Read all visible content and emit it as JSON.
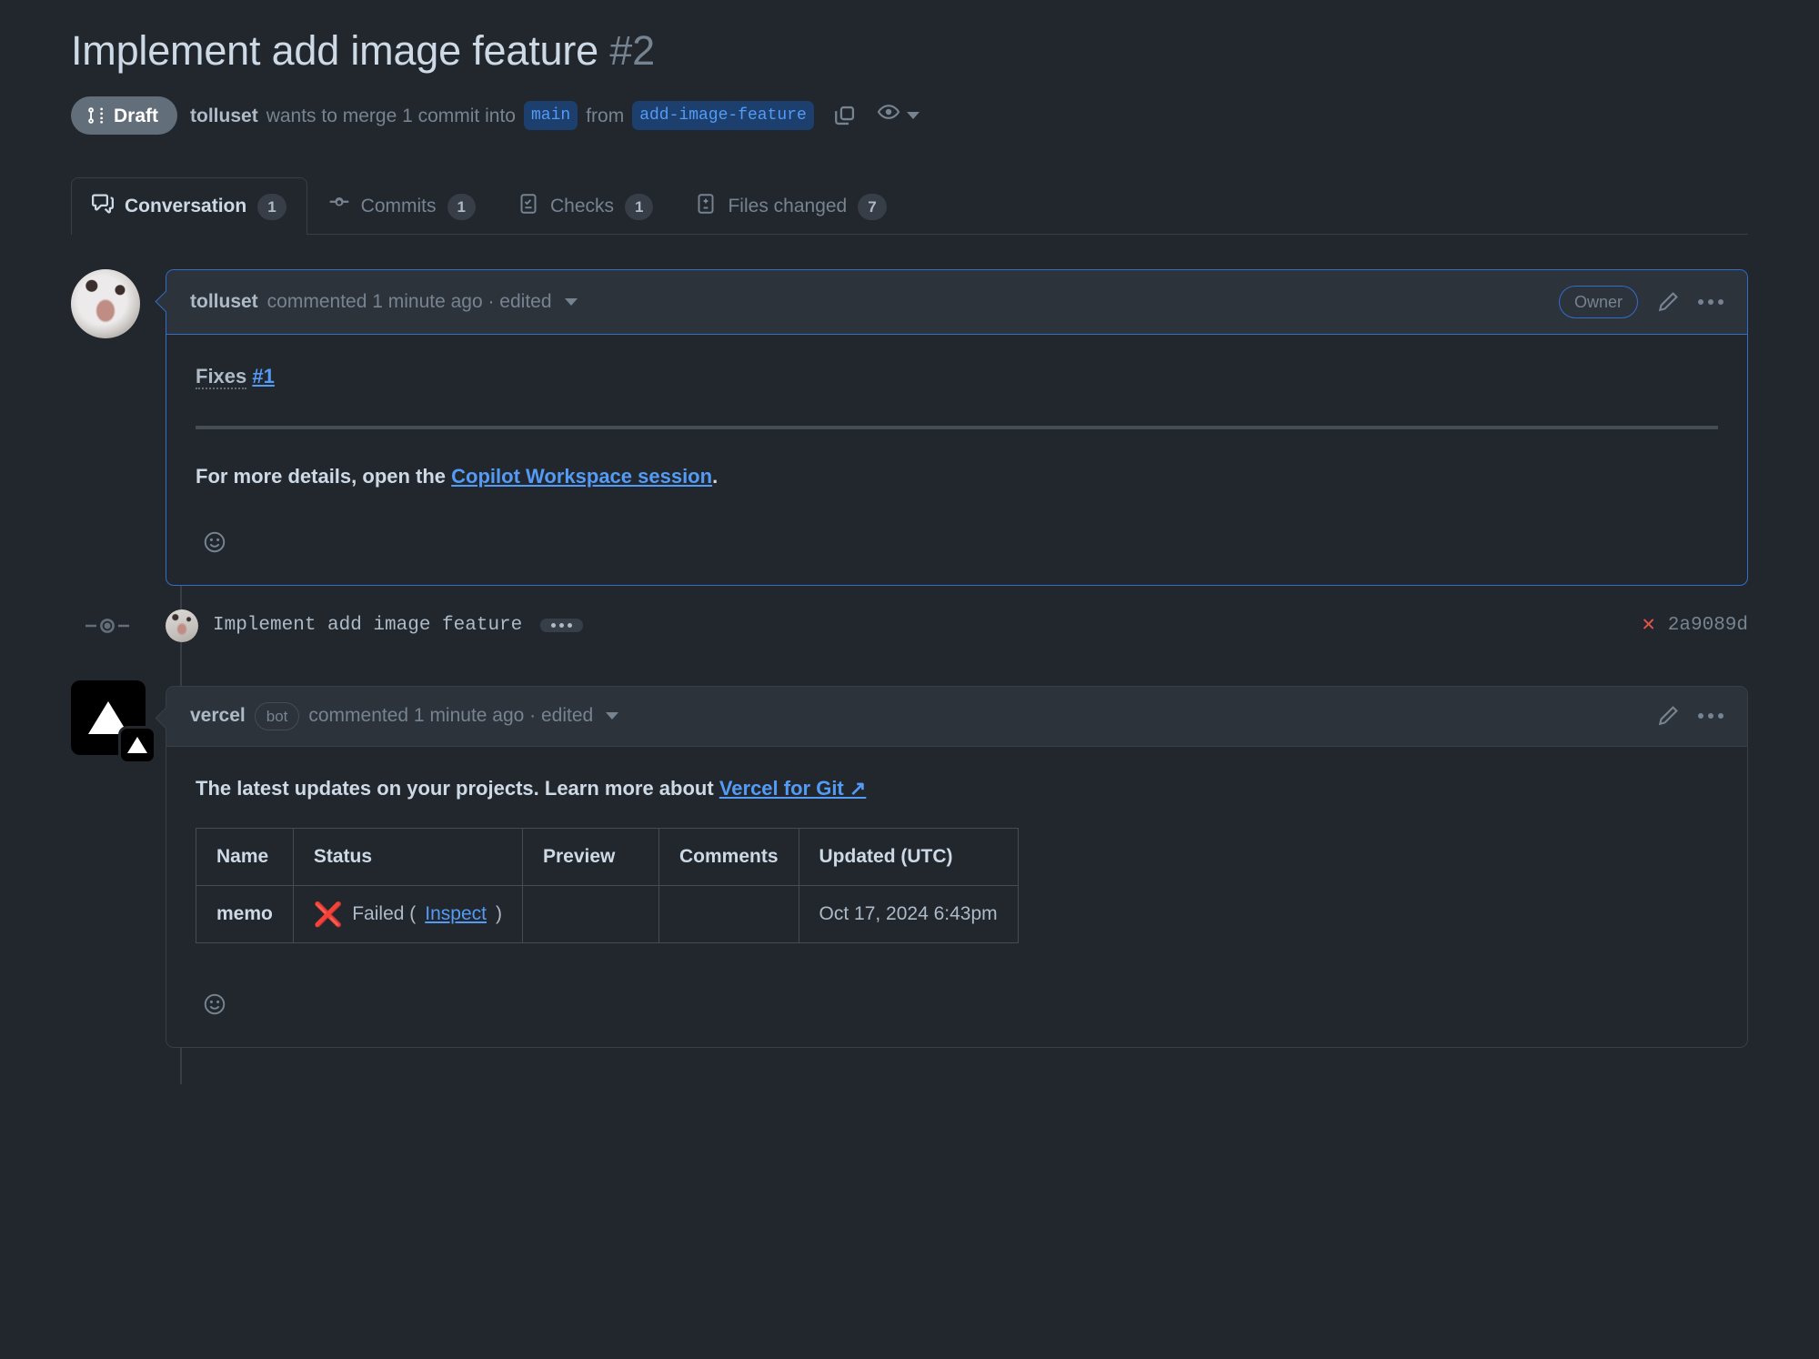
{
  "header": {
    "title": "Implement add image feature",
    "number": "#2",
    "state_badge": {
      "label": "Draft",
      "icon": "git-pull-request-draft-icon"
    },
    "merge_line": {
      "actor": "tolluset",
      "text_before": "wants to merge 1 commit into",
      "base_branch": "main",
      "text_middle": "from",
      "head_branch": "add-image-feature"
    },
    "copy_icon": "copy-icon",
    "watch_icon": "eye-icon"
  },
  "tabs": [
    {
      "label": "Conversation",
      "count": "1",
      "icon": "comment-discussion-icon",
      "active": true
    },
    {
      "label": "Commits",
      "count": "1",
      "icon": "git-commit-icon",
      "active": false
    },
    {
      "label": "Checks",
      "count": "1",
      "icon": "checklist-icon",
      "active": false
    },
    {
      "label": "Files changed",
      "count": "7",
      "icon": "file-diff-icon",
      "active": false
    }
  ],
  "comments": [
    {
      "author": "tolluset",
      "meta": "commented 1 minute ago · edited",
      "badge": "Owner",
      "body": {
        "fixes_label": "Fixes",
        "fixes_link": "#1",
        "detail_prefix": "For more details, open the",
        "detail_link": "Copilot Workspace session",
        "detail_suffix": "."
      },
      "reaction_icon": "smiley-icon",
      "edit_icon": "pencil-icon",
      "menu_icon": "kebab-horizontal-icon"
    },
    {
      "author": "vercel",
      "bot_tag": "bot",
      "meta": "commented 1 minute ago · edited",
      "body": {
        "intro_bold": "The latest updates on your projects.",
        "intro_rest": "Learn more about",
        "intro_link": "Vercel for Git ↗"
      },
      "reaction_icon": "smiley-icon",
      "edit_icon": "pencil-icon",
      "menu_icon": "kebab-horizontal-icon"
    }
  ],
  "commit_event": {
    "avatar": "tolluset-avatar",
    "message": "Implement add image feature",
    "menu_icon": "kebab-horizontal-icon",
    "status_icon": "x-failed-icon",
    "sha": "2a9089d"
  },
  "deployments_table": {
    "columns": [
      "Name",
      "Status",
      "Preview",
      "Comments",
      "Updated (UTC)"
    ],
    "rows": [
      {
        "name": "memo",
        "status_icon": "x-red-icon",
        "status_text": "Failed (",
        "status_link": "Inspect",
        "status_text_end": ")",
        "preview": "",
        "comments": "",
        "updated": "Oct 17, 2024 6:43pm"
      }
    ]
  },
  "colors": {
    "background": "#22272e",
    "surface": "#2d333b",
    "border": "#373e47",
    "accent": "#539bf5",
    "accent_border": "#316dca",
    "danger": "#e5534b",
    "muted": "#768390",
    "text": "#adbac7"
  }
}
